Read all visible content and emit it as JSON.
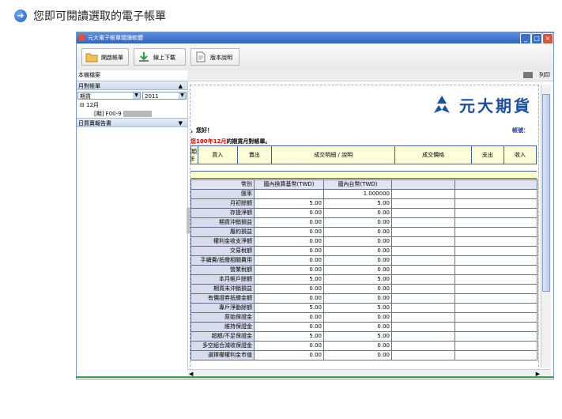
{
  "page_heading": "您即可閱讀選取的電子帳單",
  "window": {
    "title": "元大電子帳單閱讀軟體",
    "buttons": [
      "_",
      "□",
      "×"
    ]
  },
  "toolbar": {
    "open": "開啟帳單",
    "download": "線上下載",
    "version": "版本說明"
  },
  "left_pane": {
    "local_files": "本機檔案",
    "monthly_label": "月對帳單",
    "filter_type": "期貨",
    "filter_year": "2011",
    "month_node": "12月",
    "file_prefix": "[期] F00-9",
    "daily_label": "日買賣報告書"
  },
  "print_label": "列印",
  "doc": {
    "brand": "元大期貨",
    "greeting": "，您好！",
    "account_label": "帳號：",
    "note_prefix": "您",
    "note_red": "100年12月",
    "note_suffix": "的期貨月對帳單。",
    "header_cols": [
      "買入",
      "賣出",
      "成交明細 / 說明",
      "成交價格",
      "支出",
      "收入"
    ],
    "header_left": [
      "類",
      "E"
    ],
    "table_head": [
      "幣別",
      "國內換算基幣(TWD)",
      "國內台幣(TWD)"
    ],
    "rows": [
      {
        "label": "匯率",
        "a": "",
        "b": "1.000000"
      },
      {
        "label": "月初餘額",
        "a": "5.00",
        "b": "5.00"
      },
      {
        "label": "存提淨額",
        "a": "0.00",
        "b": "0.00"
      },
      {
        "label": "期貨沖銷損益",
        "a": "0.00",
        "b": "0.00"
      },
      {
        "label": "履約損益",
        "a": "0.00",
        "b": "0.00"
      },
      {
        "label": "權利金收支淨額",
        "a": "0.00",
        "b": "0.00"
      },
      {
        "label": "交易稅額",
        "a": "0.00",
        "b": "0.00"
      },
      {
        "label": "手續費/抵繳相關費用",
        "a": "0.00",
        "b": "0.00"
      },
      {
        "label": "營業稅額",
        "a": "0.00",
        "b": "0.00"
      },
      {
        "label": "本月帳戶餘額",
        "a": "5.00",
        "b": "5.00"
      },
      {
        "label": "期貨未沖銷損益",
        "a": "0.00",
        "b": "0.00"
      },
      {
        "label": "有價證券抵繳金額",
        "a": "0.00",
        "b": "0.00"
      },
      {
        "label": "專戶淨動餘額",
        "a": "5.00",
        "b": "5.00"
      },
      {
        "label": "原始保證金",
        "a": "0.00",
        "b": "0.00"
      },
      {
        "label": "維持保證金",
        "a": "0.00",
        "b": "0.00"
      },
      {
        "label": "超額/不足保證金",
        "a": "5.00",
        "b": "5.00"
      },
      {
        "label": "多空組合減收保證金",
        "a": "0.00",
        "b": "0.00"
      },
      {
        "label": "選擇權權利金市值",
        "a": "0.00",
        "b": "0.00"
      }
    ]
  }
}
